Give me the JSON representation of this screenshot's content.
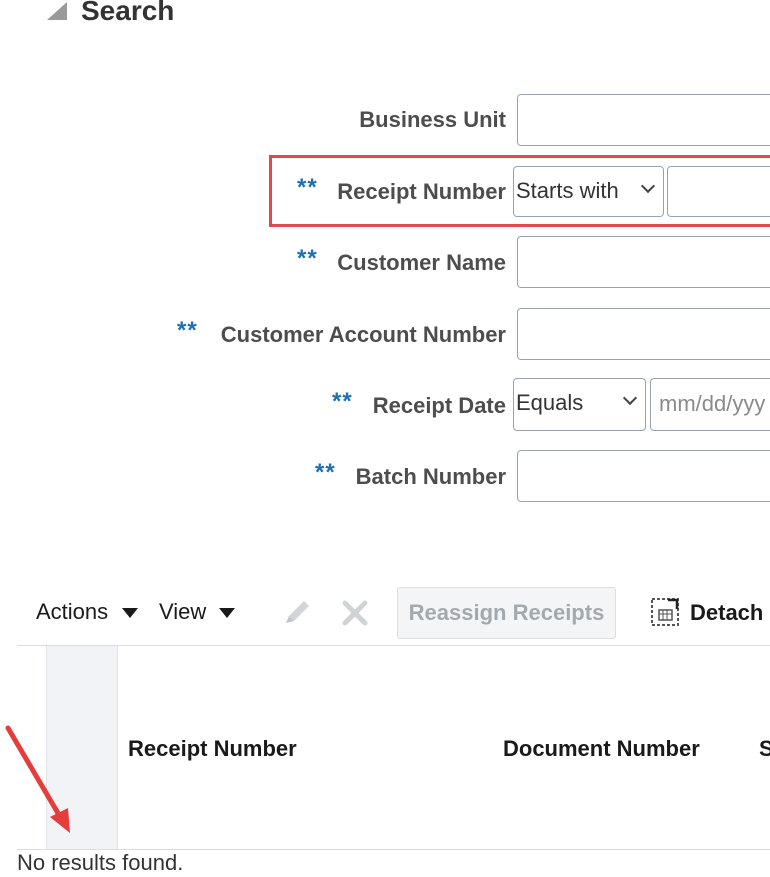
{
  "search": {
    "title": "Search",
    "required_marker": "**",
    "fields": {
      "business_unit": {
        "label": "Business Unit",
        "value": ""
      },
      "receipt_number": {
        "label": "Receipt Number",
        "operator": "Starts with",
        "value": ""
      },
      "customer_name": {
        "label": "Customer Name",
        "value": ""
      },
      "customer_account_number": {
        "label": "Customer Account Number",
        "value": ""
      },
      "receipt_date": {
        "label": "Receipt Date",
        "operator": "Equals",
        "placeholder": "mm/dd/yyy"
      },
      "batch_number": {
        "label": "Batch Number",
        "value": ""
      }
    }
  },
  "toolbar": {
    "actions_label": "Actions",
    "view_label": "View",
    "reassign_label": "Reassign Receipts",
    "detach_label": "Detach"
  },
  "table": {
    "columns": [
      "Receipt Number",
      "Document Number",
      "S"
    ],
    "empty_message": "No results found."
  },
  "colors": {
    "highlight": "#e04a4f",
    "required_marker": "#1e6fb5",
    "arrow": "#e53c3c"
  }
}
